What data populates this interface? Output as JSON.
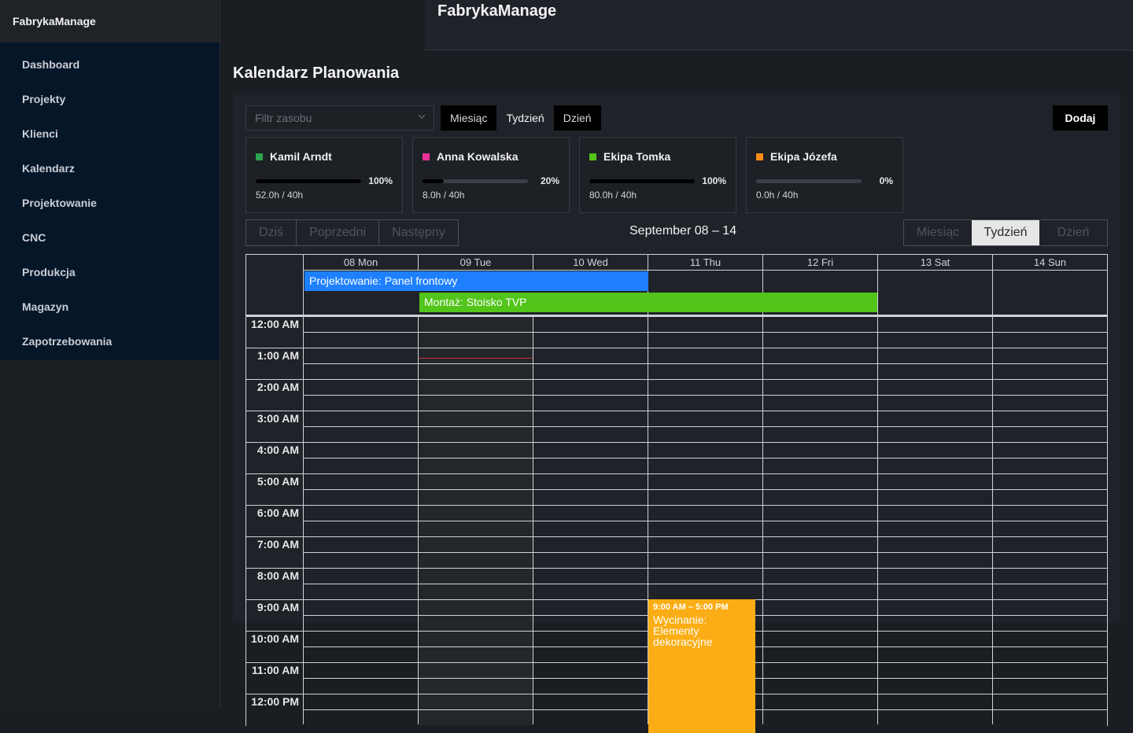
{
  "app": {
    "name": "FabrykaManage",
    "header_title": "FabrykaManage"
  },
  "sidebar": {
    "items": [
      {
        "label": "Dashboard"
      },
      {
        "label": "Projekty"
      },
      {
        "label": "Klienci"
      },
      {
        "label": "Kalendarz"
      },
      {
        "label": "Projektowanie"
      },
      {
        "label": "CNC"
      },
      {
        "label": "Produkcja"
      },
      {
        "label": "Magazyn"
      },
      {
        "label": "Zapotrzebowania"
      }
    ]
  },
  "page": {
    "title": "Kalendarz Planowania"
  },
  "toolbar": {
    "filter_placeholder": "Filtr zasobu",
    "views": [
      "Miesiąc",
      "Tydzień",
      "Dzień"
    ],
    "active_view": "Tydzień",
    "add_label": "Dodaj"
  },
  "resources": [
    {
      "name": "Kamil Arndt",
      "color": "#2ea44f",
      "percent": 100,
      "percent_label": "100%",
      "hours": "52.0h / 40h"
    },
    {
      "name": "Anna Kowalska",
      "color": "#eb2f96",
      "percent": 20,
      "percent_label": "20%",
      "hours": "8.0h / 40h"
    },
    {
      "name": "Ekipa Tomka",
      "color": "#52c41a",
      "percent": 100,
      "percent_label": "100%",
      "hours": "80.0h / 40h"
    },
    {
      "name": "Ekipa Józefa",
      "color": "#fa8c16",
      "percent": 0,
      "percent_label": "0%",
      "hours": "0.0h / 40h"
    }
  ],
  "navigation": {
    "today": "Dziś",
    "prev": "Poprzedni",
    "next": "Następny",
    "range": "September 08 – 14"
  },
  "calendar_views": [
    "Miesiąc",
    "Tydzień",
    "Dzień"
  ],
  "days": [
    "08 Mon",
    "09 Tue",
    "10 Wed",
    "11 Thu",
    "12 Fri",
    "13 Sat",
    "14 Sun"
  ],
  "times": [
    "12:00 AM",
    "1:00 AM",
    "2:00 AM",
    "3:00 AM",
    "4:00 AM",
    "5:00 AM",
    "6:00 AM",
    "7:00 AM",
    "8:00 AM",
    "9:00 AM",
    "10:00 AM",
    "11:00 AM",
    "12:00 PM"
  ],
  "events": {
    "allday": [
      {
        "title": "Projektowanie: Panel frontowy",
        "color": "#1e80ff"
      },
      {
        "title": "Montaż: Stoisko TVP",
        "color": "#52c41a"
      }
    ],
    "timed": {
      "time": "9:00 AM – 5:00 PM",
      "title": "Wycinanie: Elementy dekoracyjne",
      "color": "#faad14"
    }
  }
}
